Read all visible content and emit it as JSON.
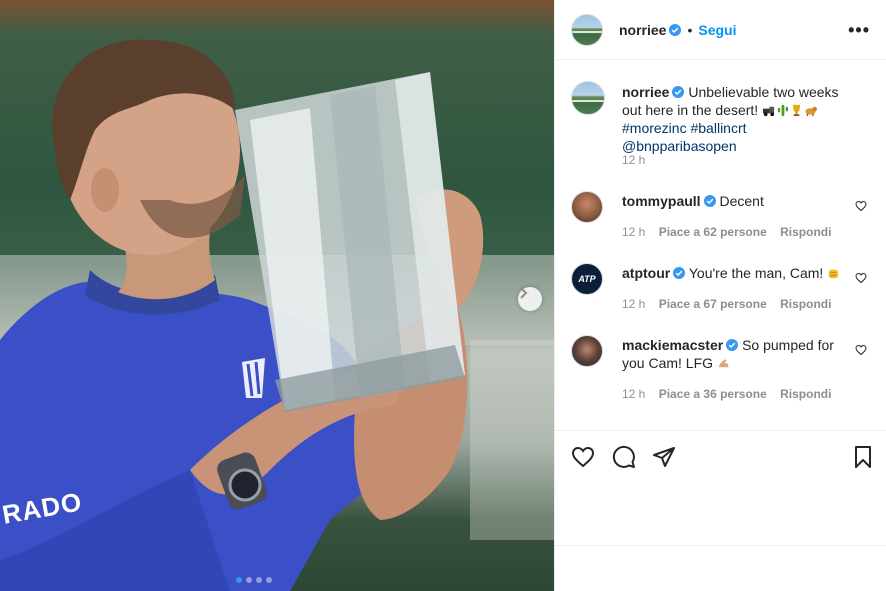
{
  "post": {
    "username": "norriee",
    "follow_label": "Segui",
    "more_label": "•••",
    "separator": "•"
  },
  "caption": {
    "username": "norriee",
    "text": "Unbelievable two weeks out here in the desert!",
    "emojis": [
      "pickup-truck",
      "cactus",
      "trophy",
      "dog"
    ],
    "hashtags": [
      "#morezinc",
      "#ballincrt"
    ],
    "mention": "@bnpparibasopen",
    "time": "12 h"
  },
  "comments": [
    {
      "username": "tommypaull",
      "text": "Decent",
      "time": "12 h",
      "likes": "Piace a 62 persone",
      "reply": "Rispondi",
      "avatar": "tommy-avatar"
    },
    {
      "username": "atptour",
      "text": "You're the man, Cam!",
      "emoji": "fist",
      "time": "12 h",
      "likes": "Piace a 67 persone",
      "reply": "Rispondi",
      "avatar": "atp-avatar",
      "avatar_text": "ATP"
    },
    {
      "username": "mackiemacster",
      "text": "So pumped for you Cam! LFG",
      "emoji": "flexed-biceps",
      "time": "12 h",
      "likes": "Piace a 36 persone",
      "reply": "Rispondi",
      "avatar": "mackie-avatar"
    }
  ],
  "photo": {
    "shirt_text": "RADO",
    "carousel_dots": 4,
    "active_dot": 0
  },
  "colors": {
    "accent": "#0095f6",
    "verified": "#3897f0",
    "muted": "#8e8e8e",
    "shirt": "#3a4fc4"
  }
}
